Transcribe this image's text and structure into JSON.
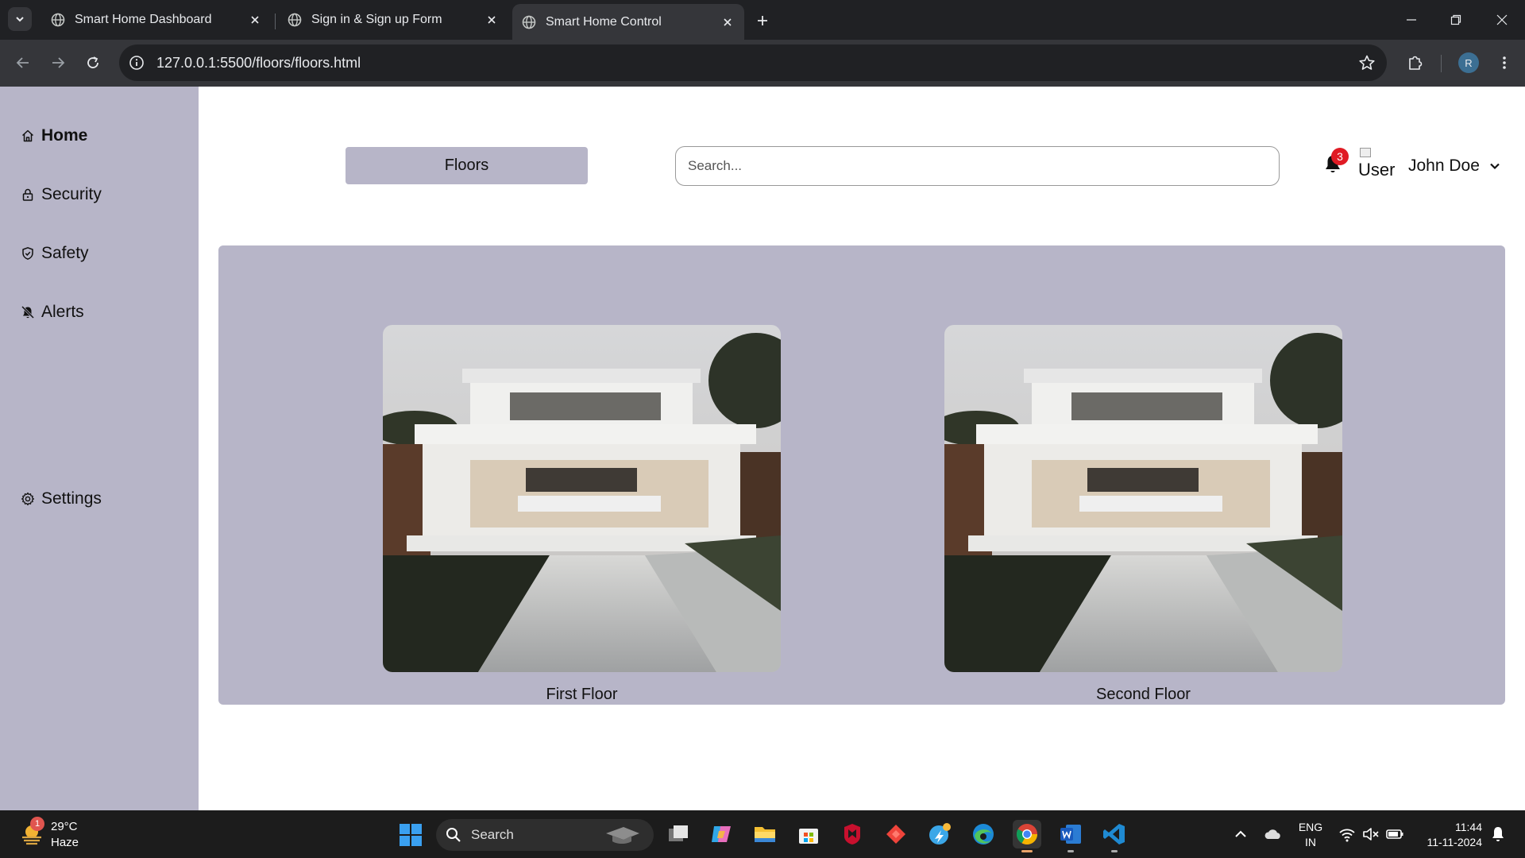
{
  "browser": {
    "tabs": [
      {
        "title": "Smart Home Dashboard",
        "active": false
      },
      {
        "title": "Sign in & Sign up Form",
        "active": false
      },
      {
        "title": "Smart Home Control",
        "active": true
      }
    ],
    "url": "127.0.0.1:5500/floors/floors.html",
    "profile_initial": "R"
  },
  "sidebar": {
    "items": [
      {
        "label": "Home",
        "icon": "home-icon",
        "active": true
      },
      {
        "label": "Security",
        "icon": "lock-icon"
      },
      {
        "label": "Safety",
        "icon": "shield-icon"
      },
      {
        "label": "Alerts",
        "icon": "bell-slash-icon"
      },
      {
        "label": "Settings",
        "icon": "gear-icon"
      }
    ]
  },
  "header": {
    "section_button": "Floors",
    "search_placeholder": "Search...",
    "notification_count": "3",
    "avatar_alt": "User",
    "user_name": "John Doe"
  },
  "floors": [
    {
      "label": "First Floor"
    },
    {
      "label": "Second Floor"
    }
  ],
  "taskbar": {
    "weather": {
      "temp": "29°C",
      "condition": "Haze",
      "badge": "1"
    },
    "search_label": "Search",
    "language": {
      "line1": "ENG",
      "line2": "IN"
    },
    "time": "11:44",
    "date": "11-11-2024"
  },
  "colors": {
    "panel": "#b7b5c8",
    "chrome_dark": "#202124",
    "chrome_toolbar": "#35363a",
    "badge_red": "#e01b24",
    "taskbar": "#1c1c1c"
  }
}
